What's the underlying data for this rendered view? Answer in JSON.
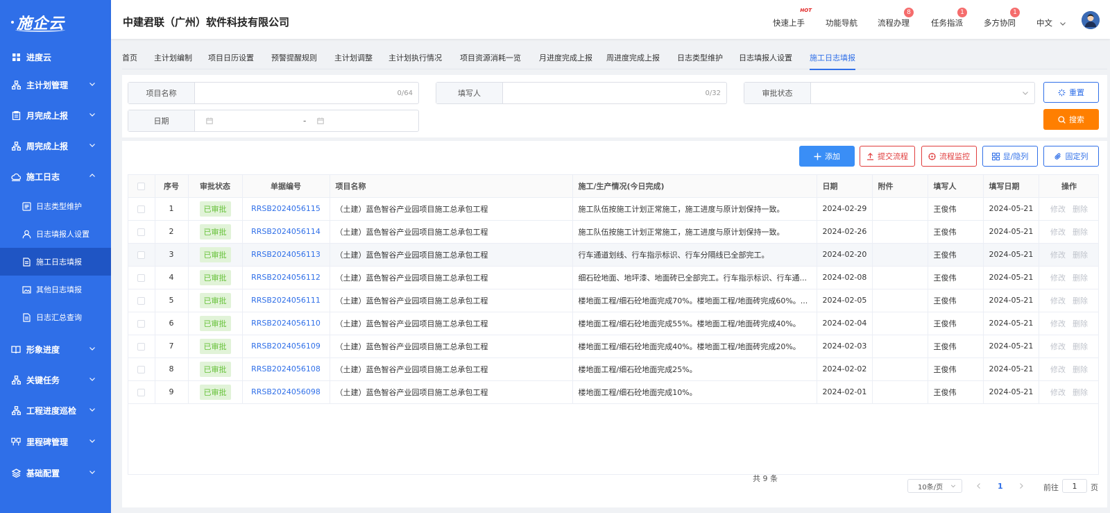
{
  "brand": {
    "logo": "施企云",
    "accent": "#2f6fe8",
    "sidebar_active": "#1f55c4"
  },
  "sidebar": {
    "items": [
      {
        "label": "进度云",
        "icon": "grid-icon",
        "expanded": false
      },
      {
        "label": "主计划管理",
        "icon": "org-chart-icon",
        "expanded": false
      },
      {
        "label": "月完成上报",
        "icon": "clipboard-icon",
        "expanded": false
      },
      {
        "label": "周完成上报",
        "icon": "org-chart-icon",
        "expanded": false
      },
      {
        "label": "施工日志",
        "icon": "cloud-icon",
        "expanded": true
      },
      {
        "label": "形象进度",
        "icon": "book-icon",
        "expanded": false
      },
      {
        "label": "关键任务",
        "icon": "org-chart-icon",
        "expanded": false
      },
      {
        "label": "工程进度巡检",
        "icon": "org-chart-icon",
        "expanded": false
      },
      {
        "label": "里程碑管理",
        "icon": "milestone-icon",
        "expanded": false
      },
      {
        "label": "基础配置",
        "icon": "layers-icon",
        "expanded": false
      }
    ],
    "subitems": [
      {
        "label": "日志类型维护",
        "icon": "list-icon"
      },
      {
        "label": "日志填报人设置",
        "icon": "user-icon"
      },
      {
        "label": "施工日志填报",
        "icon": "document-icon",
        "active": true
      },
      {
        "label": "其他日志填报",
        "icon": "image-icon"
      },
      {
        "label": "日志汇总查询",
        "icon": "document-icon"
      }
    ]
  },
  "header": {
    "company": "中建君联（广州）软件科技有限公司",
    "nav": [
      {
        "label": "快速上手",
        "badge": "",
        "hot": "HOT"
      },
      {
        "label": "功能导航",
        "badge": "",
        "hot": ""
      },
      {
        "label": "流程办理",
        "badge": "8",
        "hot": ""
      },
      {
        "label": "任务指派",
        "badge": "1",
        "hot": ""
      },
      {
        "label": "多方协同",
        "badge": "1",
        "hot": ""
      }
    ],
    "language": "中文"
  },
  "tabs": [
    "首页",
    "主计划编制",
    "项目日历设置",
    "预警提醒规则",
    "主计划调整",
    "主计划执行情况",
    "项目资源消耗一览",
    "月进度完成上报",
    "周进度完成上报",
    "日志类型维护",
    "日志填报人设置",
    "施工日志填报"
  ],
  "active_tab": 11,
  "filters": {
    "project_name": {
      "label": "项目名称",
      "value": "",
      "count": "0/64"
    },
    "filler": {
      "label": "填写人",
      "value": "",
      "count": "0/32"
    },
    "approval": {
      "label": "审批状态",
      "value": ""
    },
    "date": {
      "label": "日期",
      "separator": "-"
    },
    "reset": "重置",
    "search": "搜索"
  },
  "toolbar": {
    "add": "添加",
    "submit": "提交流程",
    "monitor": "流程监控",
    "toggle_cols": "显/隐列",
    "fix_cols": "固定列"
  },
  "table": {
    "headers": [
      "序号",
      "审批状态",
      "单据编号",
      "项目名称",
      "施工/生产情况(今日完成)",
      "日期",
      "附件",
      "填写人",
      "填写日期",
      "操作"
    ],
    "edit": "修改",
    "delete": "删除",
    "rows": [
      {
        "no": "1",
        "status": "已审批",
        "code": "RRSB2024056115",
        "project": "（土建）蓝色智谷产业园项目施工总承包工程",
        "work": "施工队伍按施工计划正常施工，施工进度与原计划保持一致。",
        "date": "2024-02-29",
        "attach": "",
        "filler": "王俊伟",
        "fill_date": "2024-05-21"
      },
      {
        "no": "2",
        "status": "已审批",
        "code": "RRSB2024056114",
        "project": "（土建）蓝色智谷产业园项目施工总承包工程",
        "work": "施工队伍按施工计划正常施工，施工进度与原计划保持一致。",
        "date": "2024-02-26",
        "attach": "",
        "filler": "王俊伟",
        "fill_date": "2024-05-21"
      },
      {
        "no": "3",
        "status": "已审批",
        "code": "RRSB2024056113",
        "project": "（土建）蓝色智谷产业园项目施工总承包工程",
        "work": "行车通道划线、行车指示标识、行车分隔线已全部完工。",
        "date": "2024-02-20",
        "attach": "",
        "filler": "王俊伟",
        "fill_date": "2024-05-21"
      },
      {
        "no": "4",
        "status": "已审批",
        "code": "RRSB2024056112",
        "project": "（土建）蓝色智谷产业园项目施工总承包工程",
        "work": "细石砼地面、地坪漆、地面砖已全部完工。行车指示标识、行车通...",
        "date": "2024-02-08",
        "attach": "",
        "filler": "王俊伟",
        "fill_date": "2024-05-21"
      },
      {
        "no": "5",
        "status": "已审批",
        "code": "RRSB2024056111",
        "project": "（土建）蓝色智谷产业园项目施工总承包工程",
        "work": "楼地面工程/细石砼地面完成70%。楼地面工程/地面砖完成60%。...",
        "date": "2024-02-05",
        "attach": "",
        "filler": "王俊伟",
        "fill_date": "2024-05-21"
      },
      {
        "no": "6",
        "status": "已审批",
        "code": "RRSB2024056110",
        "project": "（土建）蓝色智谷产业园项目施工总承包工程",
        "work": "楼地面工程/细石砼地面完成55%。楼地面工程/地面砖完成40%。",
        "date": "2024-02-04",
        "attach": "",
        "filler": "王俊伟",
        "fill_date": "2024-05-21"
      },
      {
        "no": "7",
        "status": "已审批",
        "code": "RRSB2024056109",
        "project": "（土建）蓝色智谷产业园项目施工总承包工程",
        "work": "楼地面工程/细石砼地面完成40%。楼地面工程/地面砖完成20%。",
        "date": "2024-02-03",
        "attach": "",
        "filler": "王俊伟",
        "fill_date": "2024-05-21"
      },
      {
        "no": "8",
        "status": "已审批",
        "code": "RRSB2024056108",
        "project": "（土建）蓝色智谷产业园项目施工总承包工程",
        "work": "楼地面工程/细石砼地面完成25%。",
        "date": "2024-02-02",
        "attach": "",
        "filler": "王俊伟",
        "fill_date": "2024-05-21"
      },
      {
        "no": "9",
        "status": "已审批",
        "code": "RRSB2024056098",
        "project": "（土建）蓝色智谷产业园项目施工总承包工程",
        "work": "楼地面工程/细石砼地面完成10%。",
        "date": "2024-02-01",
        "attach": "",
        "filler": "王俊伟",
        "fill_date": "2024-05-21"
      }
    ]
  },
  "pagination": {
    "total": "共 9 条",
    "page_size": "10条/页",
    "current": "1",
    "goto_prefix": "前往",
    "goto_value": "1",
    "goto_suffix": "页"
  }
}
